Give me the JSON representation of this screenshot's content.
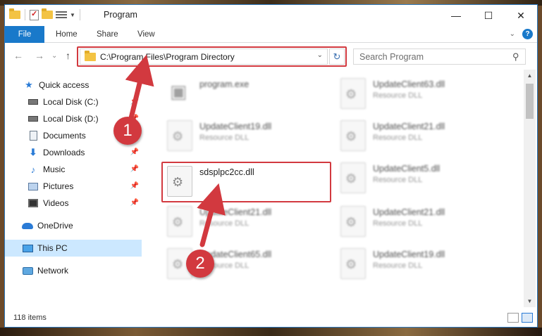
{
  "window": {
    "title": "Program",
    "minimize": "—",
    "maximize": "☐",
    "close": "✕"
  },
  "ribbon": {
    "tabs": [
      "File",
      "Home",
      "Share",
      "View"
    ],
    "expand": "⌄",
    "help": "?"
  },
  "nav_buttons": {
    "back": "←",
    "forward": "→",
    "recent": "⌄",
    "up": "↑"
  },
  "address": {
    "path": "C:\\Program Files\\Program Directory",
    "dropdown": "⌄",
    "refresh": "↻"
  },
  "search": {
    "placeholder": "Search Program",
    "icon": "⚲"
  },
  "sidebar": {
    "items": [
      {
        "label": "Quick access",
        "icon": "star-icon",
        "pinned": false
      },
      {
        "label": "Local Disk (C:)",
        "icon": "disk-icon",
        "pinned": true
      },
      {
        "label": "Local Disk (D:)",
        "icon": "disk-icon",
        "pinned": true
      },
      {
        "label": "Documents",
        "icon": "documents-icon",
        "pinned": true
      },
      {
        "label": "Downloads",
        "icon": "downloads-icon",
        "pinned": true
      },
      {
        "label": "Music",
        "icon": "music-icon",
        "pinned": true
      },
      {
        "label": "Pictures",
        "icon": "pictures-icon",
        "pinned": true
      },
      {
        "label": "Videos",
        "icon": "videos-icon",
        "pinned": true
      },
      {
        "label": "OneDrive",
        "icon": "onedrive-icon",
        "pinned": false
      },
      {
        "label": "This PC",
        "icon": "this-pc-icon",
        "pinned": false,
        "selected": true
      },
      {
        "label": "Network",
        "icon": "network-icon",
        "pinned": false
      }
    ]
  },
  "files": [
    {
      "name": "program.exe",
      "type": ""
    },
    {
      "name": "UpdateClient63.dll",
      "type": "Resource DLL"
    },
    {
      "name": "UpdateClient19.dll",
      "type": "Resource DLL"
    },
    {
      "name": "UpdateClient21.dll",
      "type": "Resource DLL"
    },
    {
      "name": "sdsplpc2cc.dll",
      "type": ""
    },
    {
      "name": "UpdateClient5.dll",
      "type": "Resource DLL"
    },
    {
      "name": "UpdateClient21.dll",
      "type": "Resource DLL"
    },
    {
      "name": "UpdateClient21.dll",
      "type": "Resource DLL"
    },
    {
      "name": "UpdateClient65.dll",
      "type": "Resource DLL"
    },
    {
      "name": "UpdateClient19.dll",
      "type": "Resource DLL"
    }
  ],
  "status": {
    "item_count": "118 items"
  },
  "annotations": {
    "step1": "1",
    "step2": "2"
  },
  "colors": {
    "accent": "#1979ca",
    "highlight": "#d2393f",
    "selection": "#cce8ff"
  }
}
